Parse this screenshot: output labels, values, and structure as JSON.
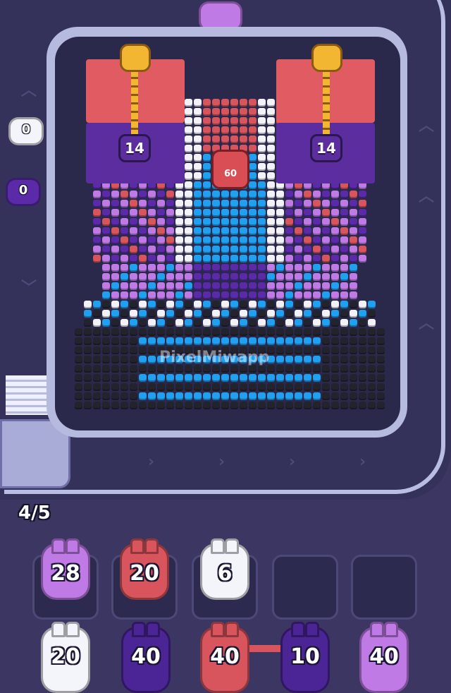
{
  "board": {
    "left_lock_count": "14",
    "right_lock_count": "14",
    "center_lock_count": "60",
    "watermark": "PixelMiwapp"
  },
  "belt": {
    "pigs": [
      {
        "value": "0",
        "color": "#f4f4fb"
      },
      {
        "value": "0",
        "color": "#5a2aa8"
      }
    ]
  },
  "queue": {
    "capacity_label": "4/5"
  },
  "slots": [
    {
      "value": "28",
      "color": "#c07ae6"
    },
    {
      "value": "20",
      "color": "#d9555d"
    },
    {
      "value": "6",
      "color": "#f4f4fb"
    },
    {
      "value": "",
      "color": ""
    },
    {
      "value": "",
      "color": ""
    }
  ],
  "reserve": [
    {
      "value": "20",
      "color": "#f4f4fb"
    },
    {
      "value": "40",
      "color": "#4b2596"
    },
    {
      "value": "40",
      "color": "#d9555d"
    },
    {
      "value": "10",
      "color": "#4b2596"
    },
    {
      "value": "40",
      "color": "#c07ae6"
    }
  ],
  "palette": {
    "blue": "#1fa0f0",
    "black": "#23232e",
    "white": "#f2f2f8",
    "purple": "#5a2aa8",
    "lilac": "#c07ae6",
    "red": "#d9555d"
  }
}
